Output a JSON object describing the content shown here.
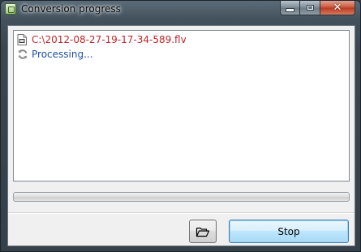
{
  "window": {
    "title": "Conversion progress",
    "icon": "app-icon",
    "controls": [
      "minimize",
      "maximize",
      "close"
    ]
  },
  "log": {
    "entries": [
      {
        "icon": "flv-file-icon",
        "text": "C:\\2012-08-27-19-17-34-589.flv",
        "color": "#c0262b"
      },
      {
        "icon": "refresh-icon",
        "text": "Processing...",
        "color": "#1f4fa3"
      }
    ]
  },
  "progress": {
    "value": 0
  },
  "buttons": {
    "open_folder_icon": "open-folder-icon",
    "stop_label": "Stop"
  },
  "colors": {
    "titlebar": "#44525d",
    "client_bg": "#f0f0f0",
    "close_button": "#c8553b",
    "focused_button": "#bee6fd"
  }
}
